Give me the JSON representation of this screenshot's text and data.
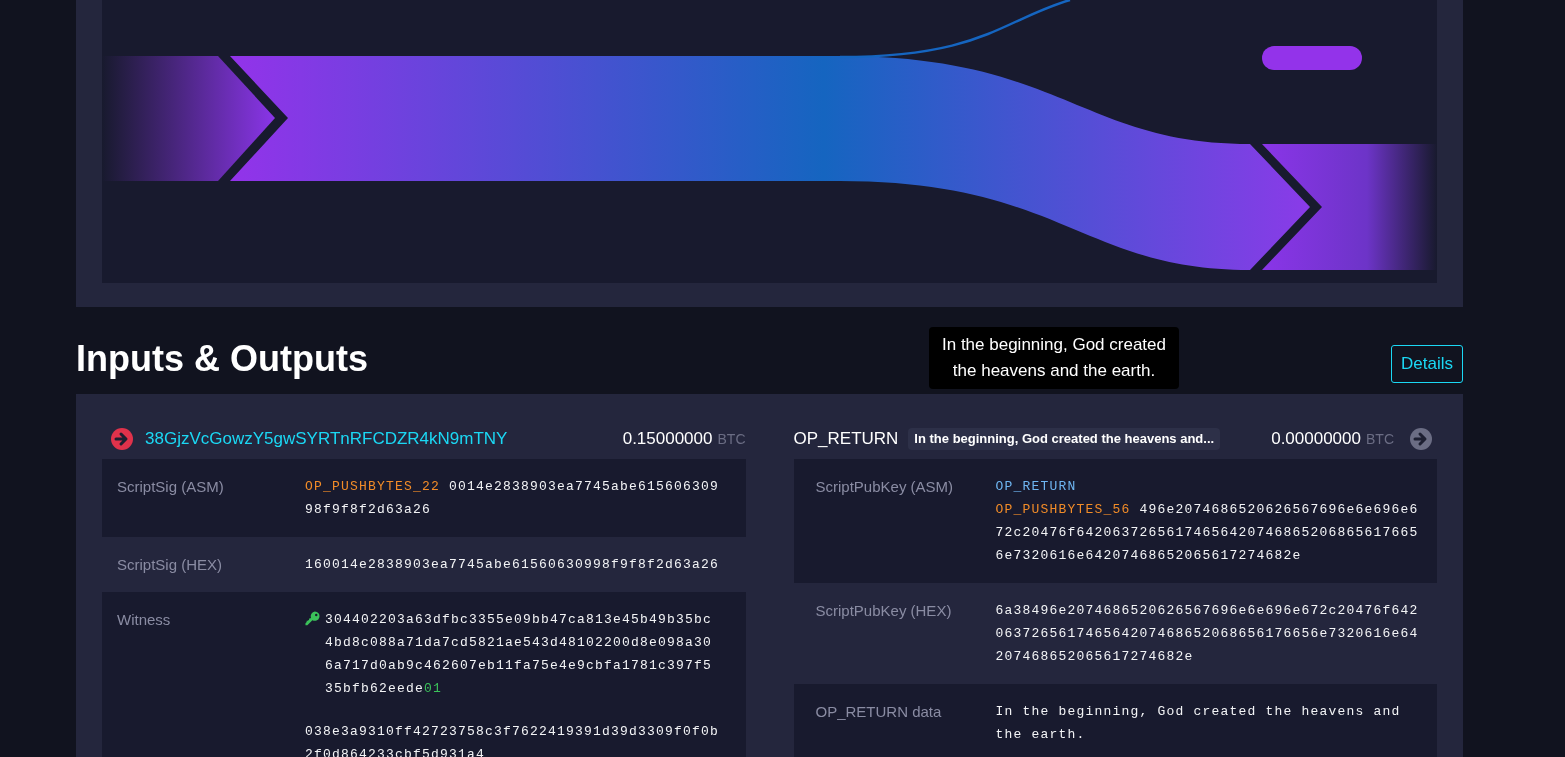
{
  "section_title": "Inputs & Outputs",
  "details_button": "Details",
  "tooltip": "In the beginning, God created the heavens and the earth.",
  "inputs": [
    {
      "address": "38GjzVcGowzY5gwSYRTnRFCDZR4kN9mTNY",
      "amount": "0.15000000",
      "unit": "BTC",
      "rows": [
        {
          "label": "ScriptSig (ASM)",
          "kind": "asm",
          "instructions": [
            {
              "op": "OP_PUSHBYTES_22",
              "kind": "push",
              "data": "0014e2838903ea7745abe61560630998f9f8f2d63a26"
            }
          ]
        },
        {
          "label": "ScriptSig (HEX)",
          "kind": "hex",
          "value": "160014e2838903ea7745abe61560630998f9f8f2d63a26"
        },
        {
          "label": "Witness",
          "kind": "witness",
          "items": [
            {
              "signature": true,
              "value": "304402203a63dfbc3355e09bb47ca813e45b49b35bc4bd8c088a71da7cd5821ae543d48102200d8e098a306a717d0ab9c462607eb11fa75e4e9cbfa1781c397f535bfb62eede",
              "sighash": "01"
            },
            {
              "signature": false,
              "value": "038e3a9310ff42723758c3f7622419391d39d3309f0f0b2f0d864233cbf5d931a4"
            }
          ]
        }
      ]
    }
  ],
  "outputs": [
    {
      "label": "OP_RETURN",
      "message": "In the beginning, God created the heavens and...",
      "amount": "0.00000000",
      "unit": "BTC",
      "rows": [
        {
          "label": "ScriptPubKey (ASM)",
          "kind": "asm",
          "instructions": [
            {
              "op": "OP_RETURN",
              "kind": "opcode"
            },
            {
              "op": "OP_PUSHBYTES_56",
              "kind": "push",
              "data": "496e2074686520626567696e6e696e672c20476f642063726561746564207468652068656176656e7320616e64207468652065617274682e"
            }
          ]
        },
        {
          "label": "ScriptPubKey (HEX)",
          "kind": "hex",
          "value": "6a38496e2074686520626567696e6e696e672c20476f642063726561746564207468652068656176656e7320616e64207468652065617274682e"
        },
        {
          "label": "OP_RETURN data",
          "kind": "text",
          "value": "In the beginning, God created the heavens and the earth."
        }
      ]
    }
  ]
}
